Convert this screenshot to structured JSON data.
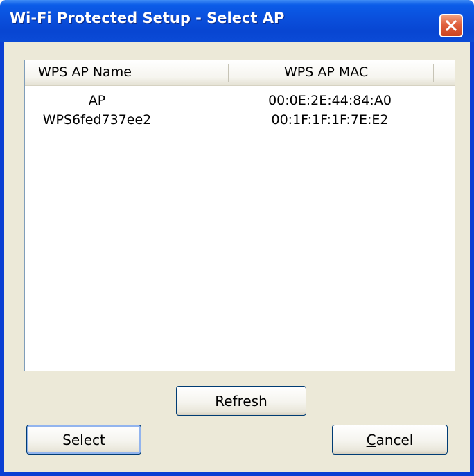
{
  "window": {
    "title": "Wi-Fi Protected Setup - Select AP"
  },
  "ap_list": {
    "columns": [
      "WPS AP Name",
      "WPS AP MAC"
    ],
    "rows": [
      {
        "name": "AP",
        "mac": "00:0E:2E:44:84:A0"
      },
      {
        "name": "WPS6fed737ee2",
        "mac": "00:1F:1F:1F:7E:E2"
      }
    ]
  },
  "buttons": {
    "refresh": "Refresh",
    "select": "Select",
    "cancel_mnemonic": "C",
    "cancel_rest": "ancel"
  },
  "colors": {
    "titlebar": "#0a4fdc",
    "client": "#ece9d8",
    "close_button": "#e0603c"
  },
  "icons": {
    "close": "close-icon"
  }
}
